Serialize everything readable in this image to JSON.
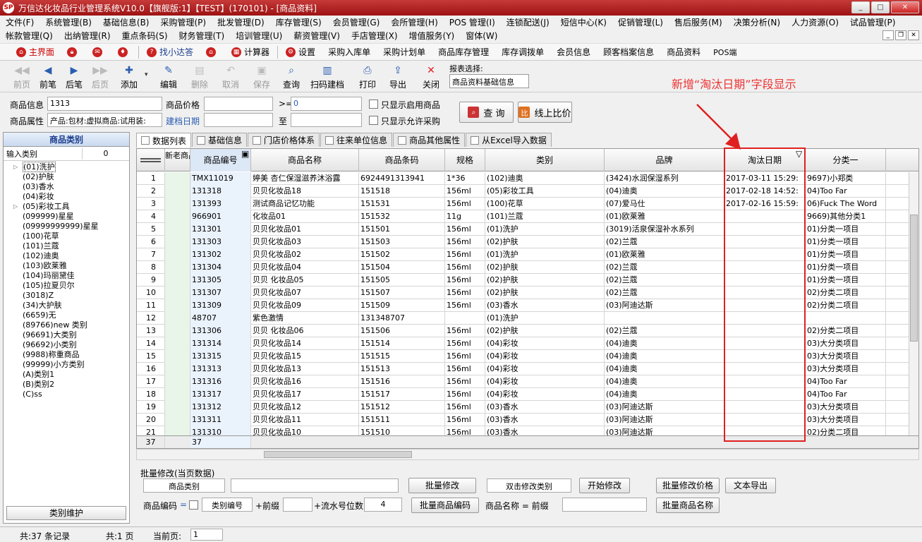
{
  "window": {
    "title": "万信达化妆品行业管理系统V10.0【旗舰版:1】【TEST】(170101) - [商品资料]",
    "logo": "SP",
    "buttons": [
      "_",
      "□",
      "✕"
    ]
  },
  "menu1": [
    "文件(F)",
    "系统管理(B)",
    "基础信息(B)",
    "采购管理(P)",
    "批发管理(D)",
    "库存管理(S)",
    "会员管理(G)",
    "会所管理(H)",
    "POS 管理(I)",
    "连锁配送(J)",
    "短信中心(K)",
    "促销管理(L)",
    "售后服务(M)",
    "决策分析(N)",
    "人力资源(O)",
    "试品管理(P)"
  ],
  "menu2": [
    "帐款管理(Q)",
    "出纳管理(R)",
    "重点条码(S)",
    "财务管理(T)",
    "培训管理(U)",
    "薪资管理(V)",
    "手店管理(X)",
    "增值服务(Y)",
    "窗体(W)"
  ],
  "quickbar": [
    "主界面",
    "",
    "",
    "",
    "找小达答",
    "",
    "计算器",
    "设置",
    "采购入库单",
    "采购计划单",
    "商品库存管理",
    "库存调拨单",
    "会员信息",
    "顾客档案信息",
    "商品资料",
    "POS端"
  ],
  "toolbar": {
    "buttons": [
      {
        "label": "前页",
        "icon": "◀◀"
      },
      {
        "label": "前笔",
        "icon": "◀"
      },
      {
        "label": "后笔",
        "icon": "▶"
      },
      {
        "label": "后页",
        "icon": "▶▶"
      },
      {
        "label": "添加",
        "icon": "✚"
      },
      {
        "label": "编辑",
        "icon": "✎"
      },
      {
        "label": "删除",
        "icon": "▤"
      },
      {
        "label": "取消",
        "icon": "↶"
      },
      {
        "label": "保存",
        "icon": "▣"
      },
      {
        "label": "查询",
        "icon": "⌕"
      },
      {
        "label": "扫码建档",
        "icon": "▥"
      },
      {
        "label": "打印",
        "icon": "⎙"
      },
      {
        "label": "导出",
        "icon": "⇪"
      },
      {
        "label": "关闭",
        "icon": "✕"
      }
    ],
    "report_label": "报表选择:",
    "report_value": "商品资料基础信息"
  },
  "annotation": "新增“淘汰日期”字段显示",
  "search": {
    "goods_info_label": "商品信息",
    "goods_info_value": "1313",
    "goods_price_label": "商品价格",
    "gte": ">=",
    "price_value": "0",
    "only_enabled": "只显示启用商品",
    "attr_label": "商品属性",
    "attr_value": "产品:包材:虚拟商品:试用装:",
    "build_date": "建档日期",
    "to": "至",
    "only_purchase": "只显示允许采购",
    "query_btn": "查 询",
    "compare_btn": "线上比价"
  },
  "left": {
    "title": "商品类别",
    "input_label": "输入类别",
    "count": "0",
    "tree": [
      "(01)洗护",
      "(02)护肤",
      "(03)香水",
      "(04)彩妆",
      "(05)彩妆工具",
      "(099999)星星",
      "(09999999999)星星",
      "(100)花草",
      "(101)兰蔻",
      "(102)迪奥",
      "(103)欧莱雅",
      "(104)玛丽黛佳",
      "(105)拉夏贝尔",
      "(3018)Z",
      "(34)大护肤",
      "(6659)无",
      "(89766)new 类别",
      "(96691)大类别",
      "(96692)小类别",
      "(9988)称重商品",
      "(99999)小方类别",
      "(A)类别1",
      "(B)类别2",
      "(C)ss"
    ],
    "maintain_btn": "类别维护"
  },
  "tabs": [
    "数据列表",
    "基础信息",
    "门店价格体系",
    "往来单位信息",
    "商品其他属性",
    "从Excel导入数据"
  ],
  "grid": {
    "headers": [
      "新老商品",
      "商品编号",
      "商品名称",
      "商品条码",
      "规格",
      "类别",
      "品牌",
      "淘汰日期",
      "分类一"
    ],
    "rows": [
      [
        "1",
        "TMX11019",
        "婷美 杏仁保湿滋养沐浴露",
        "6924491313941",
        "1*36",
        "(102)迪奥",
        "(3424)水润保湿系列",
        "2017-03-11 15:29:",
        "9697)小郑类"
      ],
      [
        "2",
        "131318",
        "贝贝化妆品18",
        "151518",
        "156ml",
        "(05)彩妆工具",
        "(04)迪奥",
        "2017-02-18 14:52:",
        "04)Too Far"
      ],
      [
        "3",
        "131393",
        "测试商品记忆功能",
        "151531",
        "156ml",
        "(100)花草",
        "(07)爱马仕",
        "2017-02-16 15:59:",
        "06)Fuck The Word"
      ],
      [
        "4",
        "966901",
        "化妆品01",
        "151532",
        "11g",
        "(101)兰蔻",
        "(01)欧莱雅",
        "",
        "9669)其他分类1"
      ],
      [
        "5",
        "131301",
        "贝贝化妆品01",
        "151501",
        "156ml",
        "(01)洗护",
        "(3019)活泉保湿补水系列",
        "",
        "01)分类一项目"
      ],
      [
        "6",
        "131303",
        "贝贝化妆品03",
        "151503",
        "156ml",
        "(02)护肤",
        "(02)兰蔻",
        "",
        "01)分类一项目"
      ],
      [
        "7",
        "131302",
        "贝贝化妆品02",
        "151502",
        "156ml",
        "(01)洗护",
        "(01)欧莱雅",
        "",
        "01)分类一项目"
      ],
      [
        "8",
        "131304",
        "贝贝化妆品04",
        "151504",
        "156ml",
        "(02)护肤",
        "(02)兰蔻",
        "",
        "01)分类一项目"
      ],
      [
        "9",
        "131305",
        "贝贝 化妆品05",
        "151505",
        "156ml",
        "(02)护肤",
        "(02)兰蔻",
        "",
        "01)分类一项目"
      ],
      [
        "10",
        "131307",
        "贝贝化妆品07",
        "151507",
        "156ml",
        "(02)护肤",
        "(02)兰蔻",
        "",
        "02)分类二项目"
      ],
      [
        "11",
        "131309",
        "贝贝化妆品09",
        "151509",
        "156ml",
        "(03)香水",
        "(03)阿迪达斯",
        "",
        "02)分类二项目"
      ],
      [
        "12",
        "48707",
        "紫色激情",
        "131348707",
        "",
        "(01)洗护",
        "",
        "",
        ""
      ],
      [
        "13",
        "131306",
        "贝贝 化妆品06",
        "151506",
        "156ml",
        "(02)护肤",
        "(02)兰蔻",
        "",
        "02)分类二项目"
      ],
      [
        "14",
        "131314",
        "贝贝化妆品14",
        "151514",
        "156ml",
        "(04)彩妆",
        "(04)迪奥",
        "",
        "03)大分类项目"
      ],
      [
        "15",
        "131315",
        "贝贝化妆品15",
        "151515",
        "156ml",
        "(04)彩妆",
        "(04)迪奥",
        "",
        "03)大分类项目"
      ],
      [
        "16",
        "131313",
        "贝贝化妆品13",
        "151513",
        "156ml",
        "(04)彩妆",
        "(04)迪奥",
        "",
        "03)大分类项目"
      ],
      [
        "17",
        "131316",
        "贝贝化妆品16",
        "151516",
        "156ml",
        "(04)彩妆",
        "(04)迪奥",
        "",
        "04)Too Far"
      ],
      [
        "18",
        "131317",
        "贝贝化妆品17",
        "151517",
        "156ml",
        "(04)彩妆",
        "(04)迪奥",
        "",
        "04)Too Far"
      ],
      [
        "19",
        "131312",
        "贝贝化妆品12",
        "151512",
        "156ml",
        "(03)香水",
        "(03)阿迪达斯",
        "",
        "03)大分类项目"
      ],
      [
        "20",
        "131311",
        "贝贝化妆品11",
        "151511",
        "156ml",
        "(03)香水",
        "(03)阿迪达斯",
        "",
        "03)大分类项目"
      ],
      [
        "21",
        "131310",
        "贝贝化妆品10",
        "151510",
        "156ml",
        "(03)香水",
        "(03)阿迪达斯",
        "",
        "02)分类二项目"
      ]
    ],
    "footer_count": "37",
    "footer_code": "37"
  },
  "batch": {
    "title": "批量修改(当页数据)",
    "category_label": "商品类别",
    "batch_modify": "批量修改",
    "dbl_click": "双击修改类别",
    "start_modify": "开始修改",
    "batch_price": "批量修改价格",
    "text_export": "文本导出",
    "code_label": "商品编码",
    "eq": "=",
    "cat_code": "类别编号",
    "prefix_plus": "+前缀",
    "serial_label": "+流水号位数",
    "serial_value": "4",
    "batch_code": "批量商品编码",
    "name_label": "商品名称 = 前缀",
    "batch_name": "批量商品名称"
  },
  "status": {
    "records": "共:37 条记录",
    "pages": "共:1 页",
    "current_label": "当前页:",
    "current": "1"
  }
}
